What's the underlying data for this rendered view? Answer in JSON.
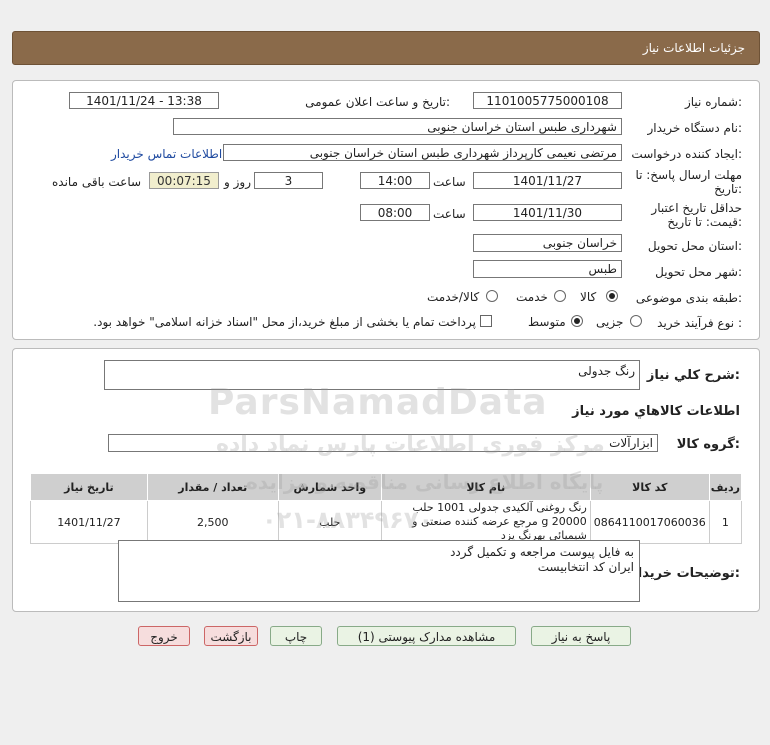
{
  "header": {
    "title": "جزئیات اطلاعات نیاز"
  },
  "fields": {
    "need_number_label": "شماره نیاز:",
    "need_number": "1101005775000108",
    "announce_label": "تاریخ و ساعت اعلان عمومی:",
    "announce_value": "1401/11/24 - 13:38",
    "buyer_org_label": "نام دستگاه خریدار:",
    "buyer_org": "شهرداری طبس استان خراسان جنوبی",
    "creator_label": "ایجاد کننده درخواست:",
    "creator": "مرتضی نعیمی کارپرداز شهرداری طبس استان خراسان جنوبی",
    "contact_link": "اطلاعات تماس خریدار",
    "deadline_label_1": "مهلت ارسال پاسخ: تا",
    "deadline_label_2": "تاریخ:",
    "deadline_date": "1401/11/27",
    "time_label": "ساعت",
    "deadline_time": "14:00",
    "days_value": "3",
    "days_label": "روز و",
    "remaining_time": "00:07:15",
    "remaining_label": "ساعت باقی مانده",
    "validity_label_1": "حداقل تاریخ اعتبار",
    "validity_label_2": "قیمت: تا تاریخ:",
    "validity_date": "1401/11/30",
    "validity_time": "08:00",
    "province_label": "استان محل تحویل:",
    "province": "خراسان جنوبی",
    "city_label": "شهر محل تحویل:",
    "city": "طبس",
    "category_label": "طبقه بندی موضوعی:",
    "category_options": [
      "کالا",
      "خدمت",
      "کالا/خدمت"
    ],
    "process_label": "نوع فرآیند خرید :",
    "process_options": [
      "جزیی",
      "متوسط"
    ],
    "payment_note": "پرداخت تمام یا بخشی از مبلغ خرید،از محل \"اسناد خزانه اسلامی\" خواهد بود."
  },
  "summary": {
    "need_desc_label": "شرح کلي نياز:",
    "need_desc": "رنگ جدولی",
    "goods_info_title": "اطلاعات کالاهاي مورد نياز",
    "goods_group_label": "گروه کالا:",
    "goods_group": "ابزارآلات"
  },
  "table": {
    "headers": [
      "ردیف",
      "کد کالا",
      "نام کالا",
      "واحد شمارش",
      "تعداد / مقدار",
      "تاریخ نیاز"
    ],
    "rows": [
      [
        "1",
        "0864110017060036",
        "رنگ روغنی آلکیدی جدولی 1001 حلب 20000 g مرجع عرضه کننده صنعتی و شیمیائی بهرنگ یزد",
        "حلب",
        "2,500",
        "1401/11/27"
      ]
    ]
  },
  "buyer_notes": {
    "label": "توضیحات خریدار:",
    "line1": "به فایل پیوست مراجعه و تکمیل گردد",
    "line2": "ایران کد انتخابیست"
  },
  "buttons": {
    "reply": "پاسخ به نیاز",
    "attachments": "مشاهده مدارک پیوستی (1)",
    "print": "چاپ",
    "back": "بازگشت",
    "exit": "خروج"
  },
  "watermark": {
    "brand": "ParsNamadData",
    "fa_line1": "مرکز فوری اطلاعات پارس نماد داده",
    "fa_line2": "پایگاه اطلاع رسانی مناقصه و مزایده",
    "phone": "۰۲۱-۸۸۳۴۹۶۷۰"
  }
}
